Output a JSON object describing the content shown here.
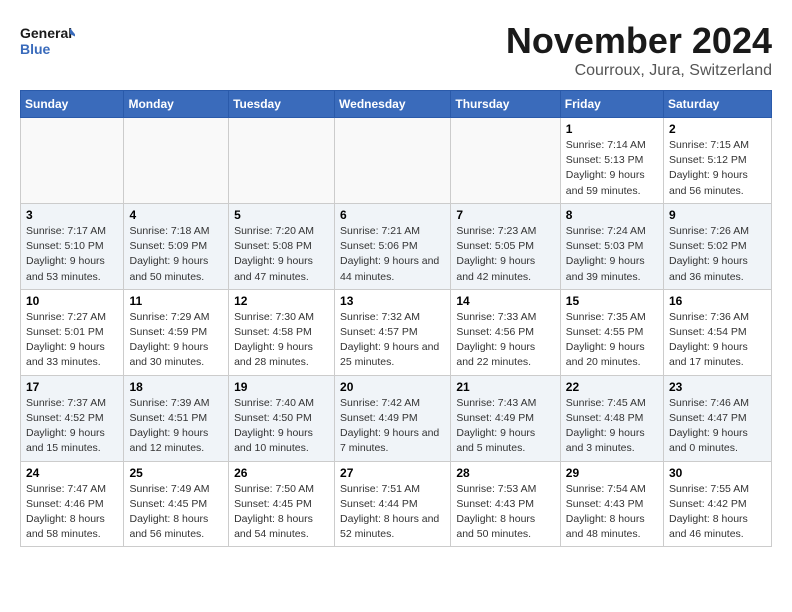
{
  "header": {
    "logo_general": "General",
    "logo_blue": "Blue",
    "month_title": "November 2024",
    "location": "Courroux, Jura, Switzerland"
  },
  "weekdays": [
    "Sunday",
    "Monday",
    "Tuesday",
    "Wednesday",
    "Thursday",
    "Friday",
    "Saturday"
  ],
  "weeks": [
    [
      {
        "day": "",
        "info": ""
      },
      {
        "day": "",
        "info": ""
      },
      {
        "day": "",
        "info": ""
      },
      {
        "day": "",
        "info": ""
      },
      {
        "day": "",
        "info": ""
      },
      {
        "day": "1",
        "info": "Sunrise: 7:14 AM\nSunset: 5:13 PM\nDaylight: 9 hours and 59 minutes."
      },
      {
        "day": "2",
        "info": "Sunrise: 7:15 AM\nSunset: 5:12 PM\nDaylight: 9 hours and 56 minutes."
      }
    ],
    [
      {
        "day": "3",
        "info": "Sunrise: 7:17 AM\nSunset: 5:10 PM\nDaylight: 9 hours and 53 minutes."
      },
      {
        "day": "4",
        "info": "Sunrise: 7:18 AM\nSunset: 5:09 PM\nDaylight: 9 hours and 50 minutes."
      },
      {
        "day": "5",
        "info": "Sunrise: 7:20 AM\nSunset: 5:08 PM\nDaylight: 9 hours and 47 minutes."
      },
      {
        "day": "6",
        "info": "Sunrise: 7:21 AM\nSunset: 5:06 PM\nDaylight: 9 hours and 44 minutes."
      },
      {
        "day": "7",
        "info": "Sunrise: 7:23 AM\nSunset: 5:05 PM\nDaylight: 9 hours and 42 minutes."
      },
      {
        "day": "8",
        "info": "Sunrise: 7:24 AM\nSunset: 5:03 PM\nDaylight: 9 hours and 39 minutes."
      },
      {
        "day": "9",
        "info": "Sunrise: 7:26 AM\nSunset: 5:02 PM\nDaylight: 9 hours and 36 minutes."
      }
    ],
    [
      {
        "day": "10",
        "info": "Sunrise: 7:27 AM\nSunset: 5:01 PM\nDaylight: 9 hours and 33 minutes."
      },
      {
        "day": "11",
        "info": "Sunrise: 7:29 AM\nSunset: 4:59 PM\nDaylight: 9 hours and 30 minutes."
      },
      {
        "day": "12",
        "info": "Sunrise: 7:30 AM\nSunset: 4:58 PM\nDaylight: 9 hours and 28 minutes."
      },
      {
        "day": "13",
        "info": "Sunrise: 7:32 AM\nSunset: 4:57 PM\nDaylight: 9 hours and 25 minutes."
      },
      {
        "day": "14",
        "info": "Sunrise: 7:33 AM\nSunset: 4:56 PM\nDaylight: 9 hours and 22 minutes."
      },
      {
        "day": "15",
        "info": "Sunrise: 7:35 AM\nSunset: 4:55 PM\nDaylight: 9 hours and 20 minutes."
      },
      {
        "day": "16",
        "info": "Sunrise: 7:36 AM\nSunset: 4:54 PM\nDaylight: 9 hours and 17 minutes."
      }
    ],
    [
      {
        "day": "17",
        "info": "Sunrise: 7:37 AM\nSunset: 4:52 PM\nDaylight: 9 hours and 15 minutes."
      },
      {
        "day": "18",
        "info": "Sunrise: 7:39 AM\nSunset: 4:51 PM\nDaylight: 9 hours and 12 minutes."
      },
      {
        "day": "19",
        "info": "Sunrise: 7:40 AM\nSunset: 4:50 PM\nDaylight: 9 hours and 10 minutes."
      },
      {
        "day": "20",
        "info": "Sunrise: 7:42 AM\nSunset: 4:49 PM\nDaylight: 9 hours and 7 minutes."
      },
      {
        "day": "21",
        "info": "Sunrise: 7:43 AM\nSunset: 4:49 PM\nDaylight: 9 hours and 5 minutes."
      },
      {
        "day": "22",
        "info": "Sunrise: 7:45 AM\nSunset: 4:48 PM\nDaylight: 9 hours and 3 minutes."
      },
      {
        "day": "23",
        "info": "Sunrise: 7:46 AM\nSunset: 4:47 PM\nDaylight: 9 hours and 0 minutes."
      }
    ],
    [
      {
        "day": "24",
        "info": "Sunrise: 7:47 AM\nSunset: 4:46 PM\nDaylight: 8 hours and 58 minutes."
      },
      {
        "day": "25",
        "info": "Sunrise: 7:49 AM\nSunset: 4:45 PM\nDaylight: 8 hours and 56 minutes."
      },
      {
        "day": "26",
        "info": "Sunrise: 7:50 AM\nSunset: 4:45 PM\nDaylight: 8 hours and 54 minutes."
      },
      {
        "day": "27",
        "info": "Sunrise: 7:51 AM\nSunset: 4:44 PM\nDaylight: 8 hours and 52 minutes."
      },
      {
        "day": "28",
        "info": "Sunrise: 7:53 AM\nSunset: 4:43 PM\nDaylight: 8 hours and 50 minutes."
      },
      {
        "day": "29",
        "info": "Sunrise: 7:54 AM\nSunset: 4:43 PM\nDaylight: 8 hours and 48 minutes."
      },
      {
        "day": "30",
        "info": "Sunrise: 7:55 AM\nSunset: 4:42 PM\nDaylight: 8 hours and 46 minutes."
      }
    ]
  ]
}
